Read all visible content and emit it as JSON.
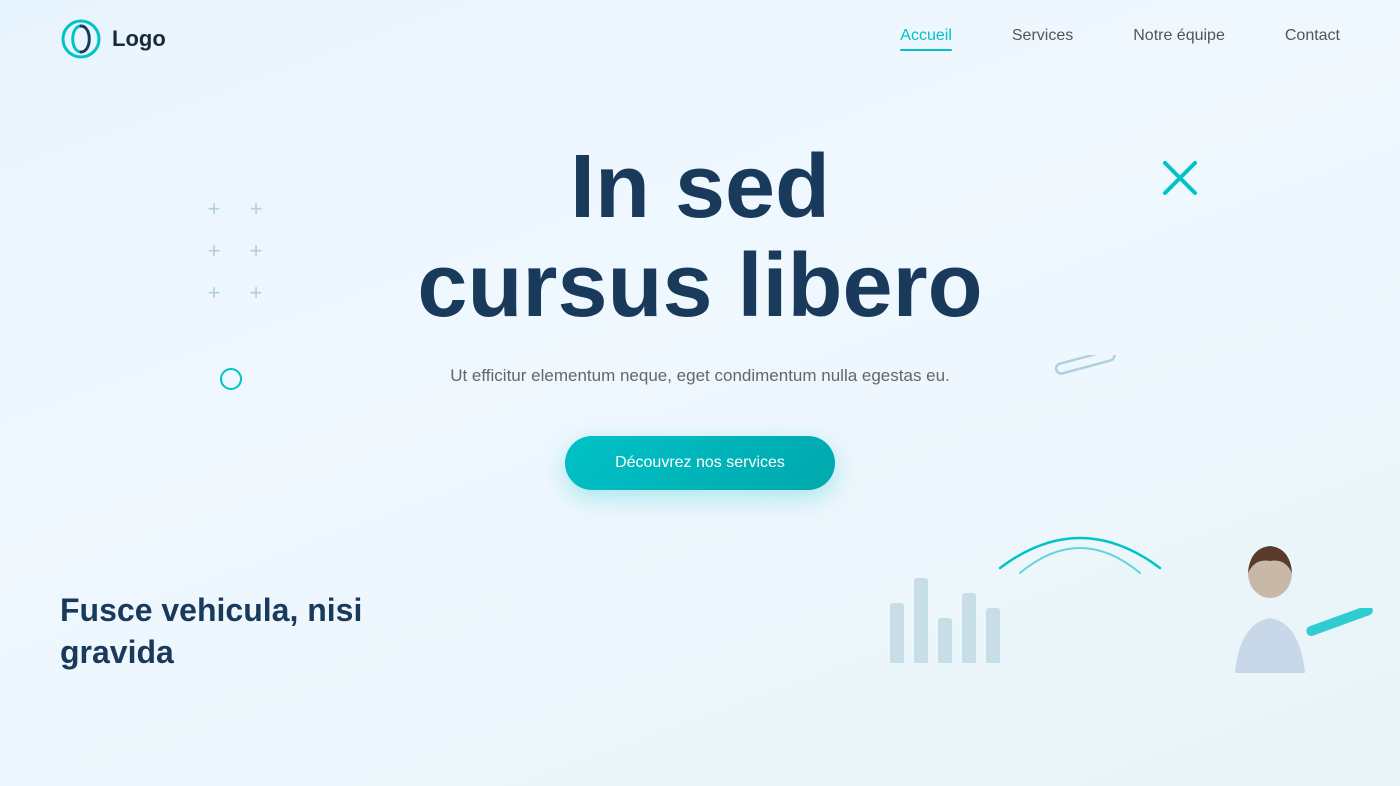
{
  "logo": {
    "text": "Logo"
  },
  "nav": {
    "links": [
      {
        "id": "accueil",
        "label": "Accueil",
        "active": true
      },
      {
        "id": "services",
        "label": "Services",
        "active": false
      },
      {
        "id": "notre-equipe",
        "label": "Notre équipe",
        "active": false
      },
      {
        "id": "contact",
        "label": "Contact",
        "active": false
      }
    ]
  },
  "hero": {
    "title_line1": "In sed",
    "title_line2": "cursus libero",
    "subtitle": "Ut efficitur elementum neque, eget condimentum nulla egestas eu.",
    "cta_label": "Découvrez nos services"
  },
  "second_section": {
    "title": "Fusce vehicula, nisi gravida"
  },
  "colors": {
    "accent": "#00c2c7",
    "heading": "#1a3a5c",
    "deco": "#b0cfe0"
  },
  "decorations": {
    "x_icon": "✕",
    "plus": "+"
  }
}
